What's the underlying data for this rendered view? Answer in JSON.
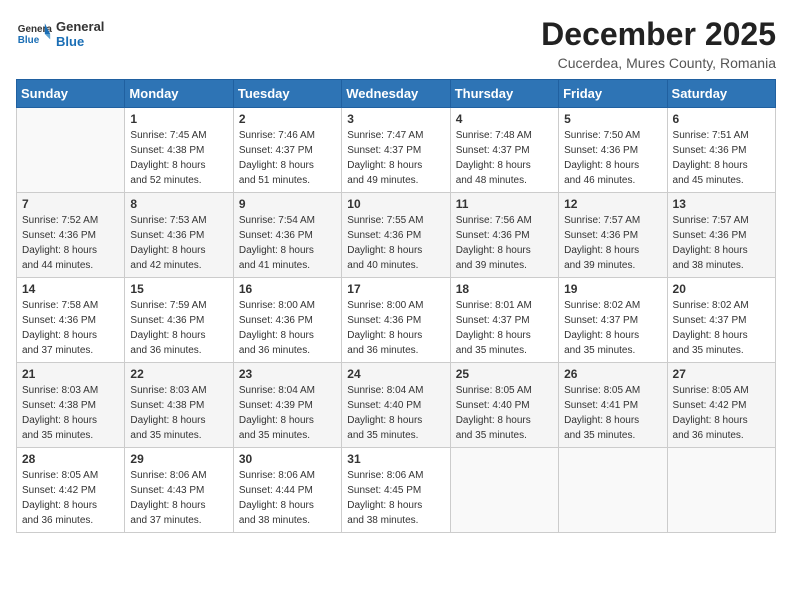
{
  "header": {
    "logo_general": "General",
    "logo_blue": "Blue",
    "month_title": "December 2025",
    "subtitle": "Cucerdea, Mures County, Romania"
  },
  "weekdays": [
    "Sunday",
    "Monday",
    "Tuesday",
    "Wednesday",
    "Thursday",
    "Friday",
    "Saturday"
  ],
  "weeks": [
    [
      {
        "day": "",
        "info": ""
      },
      {
        "day": "1",
        "info": "Sunrise: 7:45 AM\nSunset: 4:38 PM\nDaylight: 8 hours\nand 52 minutes."
      },
      {
        "day": "2",
        "info": "Sunrise: 7:46 AM\nSunset: 4:37 PM\nDaylight: 8 hours\nand 51 minutes."
      },
      {
        "day": "3",
        "info": "Sunrise: 7:47 AM\nSunset: 4:37 PM\nDaylight: 8 hours\nand 49 minutes."
      },
      {
        "day": "4",
        "info": "Sunrise: 7:48 AM\nSunset: 4:37 PM\nDaylight: 8 hours\nand 48 minutes."
      },
      {
        "day": "5",
        "info": "Sunrise: 7:50 AM\nSunset: 4:36 PM\nDaylight: 8 hours\nand 46 minutes."
      },
      {
        "day": "6",
        "info": "Sunrise: 7:51 AM\nSunset: 4:36 PM\nDaylight: 8 hours\nand 45 minutes."
      }
    ],
    [
      {
        "day": "7",
        "info": "Sunrise: 7:52 AM\nSunset: 4:36 PM\nDaylight: 8 hours\nand 44 minutes."
      },
      {
        "day": "8",
        "info": "Sunrise: 7:53 AM\nSunset: 4:36 PM\nDaylight: 8 hours\nand 42 minutes."
      },
      {
        "day": "9",
        "info": "Sunrise: 7:54 AM\nSunset: 4:36 PM\nDaylight: 8 hours\nand 41 minutes."
      },
      {
        "day": "10",
        "info": "Sunrise: 7:55 AM\nSunset: 4:36 PM\nDaylight: 8 hours\nand 40 minutes."
      },
      {
        "day": "11",
        "info": "Sunrise: 7:56 AM\nSunset: 4:36 PM\nDaylight: 8 hours\nand 39 minutes."
      },
      {
        "day": "12",
        "info": "Sunrise: 7:57 AM\nSunset: 4:36 PM\nDaylight: 8 hours\nand 39 minutes."
      },
      {
        "day": "13",
        "info": "Sunrise: 7:57 AM\nSunset: 4:36 PM\nDaylight: 8 hours\nand 38 minutes."
      }
    ],
    [
      {
        "day": "14",
        "info": "Sunrise: 7:58 AM\nSunset: 4:36 PM\nDaylight: 8 hours\nand 37 minutes."
      },
      {
        "day": "15",
        "info": "Sunrise: 7:59 AM\nSunset: 4:36 PM\nDaylight: 8 hours\nand 36 minutes."
      },
      {
        "day": "16",
        "info": "Sunrise: 8:00 AM\nSunset: 4:36 PM\nDaylight: 8 hours\nand 36 minutes."
      },
      {
        "day": "17",
        "info": "Sunrise: 8:00 AM\nSunset: 4:36 PM\nDaylight: 8 hours\nand 36 minutes."
      },
      {
        "day": "18",
        "info": "Sunrise: 8:01 AM\nSunset: 4:37 PM\nDaylight: 8 hours\nand 35 minutes."
      },
      {
        "day": "19",
        "info": "Sunrise: 8:02 AM\nSunset: 4:37 PM\nDaylight: 8 hours\nand 35 minutes."
      },
      {
        "day": "20",
        "info": "Sunrise: 8:02 AM\nSunset: 4:37 PM\nDaylight: 8 hours\nand 35 minutes."
      }
    ],
    [
      {
        "day": "21",
        "info": "Sunrise: 8:03 AM\nSunset: 4:38 PM\nDaylight: 8 hours\nand 35 minutes."
      },
      {
        "day": "22",
        "info": "Sunrise: 8:03 AM\nSunset: 4:38 PM\nDaylight: 8 hours\nand 35 minutes."
      },
      {
        "day": "23",
        "info": "Sunrise: 8:04 AM\nSunset: 4:39 PM\nDaylight: 8 hours\nand 35 minutes."
      },
      {
        "day": "24",
        "info": "Sunrise: 8:04 AM\nSunset: 4:40 PM\nDaylight: 8 hours\nand 35 minutes."
      },
      {
        "day": "25",
        "info": "Sunrise: 8:05 AM\nSunset: 4:40 PM\nDaylight: 8 hours\nand 35 minutes."
      },
      {
        "day": "26",
        "info": "Sunrise: 8:05 AM\nSunset: 4:41 PM\nDaylight: 8 hours\nand 35 minutes."
      },
      {
        "day": "27",
        "info": "Sunrise: 8:05 AM\nSunset: 4:42 PM\nDaylight: 8 hours\nand 36 minutes."
      }
    ],
    [
      {
        "day": "28",
        "info": "Sunrise: 8:05 AM\nSunset: 4:42 PM\nDaylight: 8 hours\nand 36 minutes."
      },
      {
        "day": "29",
        "info": "Sunrise: 8:06 AM\nSunset: 4:43 PM\nDaylight: 8 hours\nand 37 minutes."
      },
      {
        "day": "30",
        "info": "Sunrise: 8:06 AM\nSunset: 4:44 PM\nDaylight: 8 hours\nand 38 minutes."
      },
      {
        "day": "31",
        "info": "Sunrise: 8:06 AM\nSunset: 4:45 PM\nDaylight: 8 hours\nand 38 minutes."
      },
      {
        "day": "",
        "info": ""
      },
      {
        "day": "",
        "info": ""
      },
      {
        "day": "",
        "info": ""
      }
    ]
  ]
}
